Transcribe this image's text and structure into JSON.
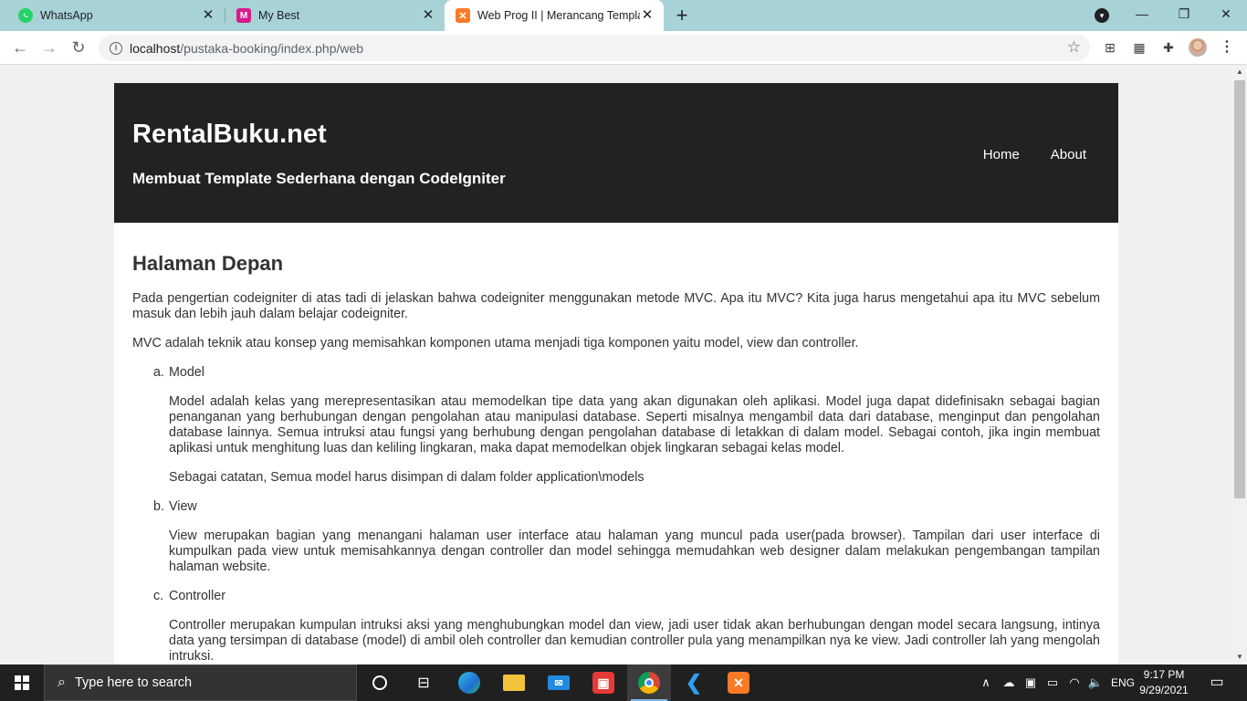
{
  "browser": {
    "tabs": [
      {
        "title": "WhatsApp",
        "icon": "whatsapp-icon",
        "active": false
      },
      {
        "title": "My Best",
        "icon": "my-best-icon",
        "active": false
      },
      {
        "title": "Web Prog II | Merancang Templa",
        "icon": "xampp-icon",
        "active": true
      }
    ],
    "address": {
      "host": "localhost",
      "path": "/pustaka-booking/index.php/web"
    }
  },
  "page": {
    "site_title": "RentalBuku.net",
    "site_subtitle": "Membuat Template Sederhana dengan CodeIgniter",
    "nav": [
      "Home",
      "About"
    ],
    "heading": "Halaman Depan",
    "intro1": "Pada pengertian codeigniter di atas tadi di jelaskan bahwa codeigniter menggunakan metode MVC. Apa itu MVC? Kita juga harus mengetahui apa itu MVC sebelum masuk dan lebih jauh dalam belajar codeigniter.",
    "intro2": "MVC adalah teknik atau konsep yang memisahkan komponen utama menjadi tiga komponen yaitu model, view dan controller.",
    "items": [
      {
        "marker": "a.",
        "title": "Model",
        "paragraphs": [
          "Model adalah kelas yang merepresentasikan atau memodelkan tipe data yang akan digunakan oleh aplikasi. Model juga dapat didefinisakn sebagai bagian penanganan yang berhubungan dengan pengolahan atau manipulasi database. Seperti misalnya mengambil data dari database, menginput dan pengolahan database lainnya. Semua intruksi atau fungsi yang berhubung dengan pengolahan database di letakkan di dalam model. Sebagai contoh, jika ingin membuat aplikasi untuk menghitung luas dan keliling lingkaran, maka dapat memodelkan objek lingkaran sebagai kelas model.",
          "Sebagai catatan, Semua model harus disimpan di dalam folder application\\models"
        ]
      },
      {
        "marker": "b.",
        "title": "View",
        "paragraphs": [
          "View merupakan bagian yang menangani halaman user interface atau halaman yang muncul pada user(pada browser). Tampilan dari user interface di kumpulkan pada view untuk memisahkannya dengan controller dan model sehingga memudahkan web designer dalam melakukan pengembangan tampilan halaman website."
        ]
      },
      {
        "marker": "c.",
        "title": "Controller",
        "paragraphs": [
          "Controller merupakan kumpulan intruksi aksi yang menghubungkan model dan view, jadi user tidak akan berhubungan dengan model secara langsung, intinya data yang tersimpan di database (model) di ambil oleh controller dan kemudian controller pula yang menampilkan nya ke view. Jadi controller lah yang mengolah intruksi."
        ]
      }
    ]
  },
  "taskbar": {
    "search_placeholder": "Type here to search",
    "language": "ENG",
    "time": "9:17 PM",
    "date": "9/29/2021"
  }
}
